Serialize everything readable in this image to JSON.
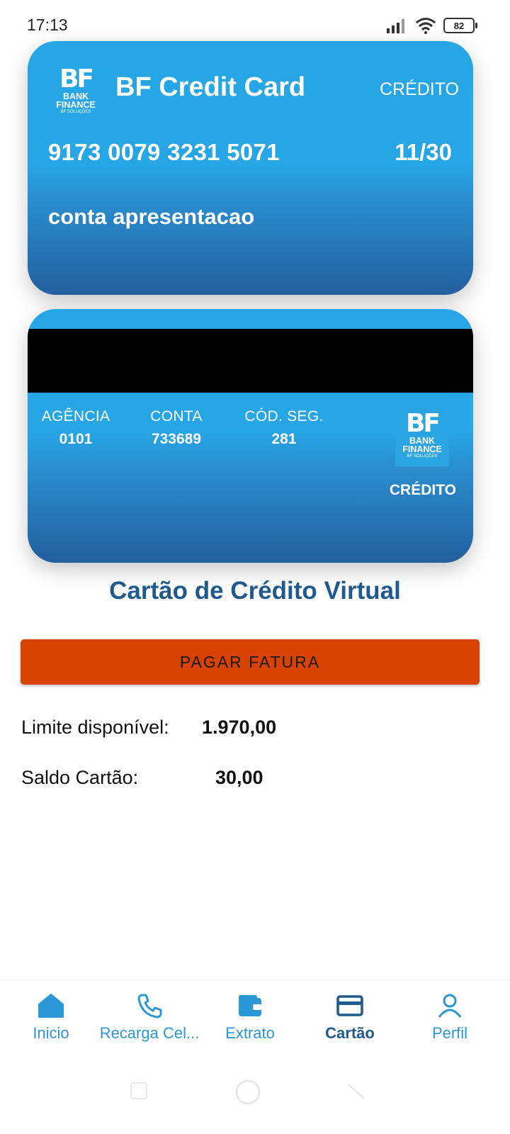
{
  "status_bar": {
    "time": "17:13",
    "battery": "82",
    "icons": [
      "signal-icon",
      "wifi-icon",
      "battery-icon"
    ]
  },
  "card_front": {
    "logo": {
      "monogram": "BF",
      "name": "BANK FINANCE",
      "tagline": "BF SOLUÇÕES"
    },
    "title": "BF Credit Card",
    "type": "CRÉDITO",
    "number": "9173 0079 3231 5071",
    "expiry": "11/30",
    "holder": "conta apresentacao"
  },
  "card_back": {
    "agencia_label": "AGÊNCIA",
    "agencia_value": "0101",
    "conta_label": "CONTA",
    "conta_value": "733689",
    "cod_label": "CÓD. SEG.",
    "cod_value": "281",
    "logo": {
      "monogram": "BF",
      "name": "BANK FINANCE",
      "tagline": "BF SOLUÇÕES"
    },
    "type": "CRÉDITO"
  },
  "main": {
    "title": "Cartão de Crédito Virtual",
    "pay_button": "PAGAR FATURA",
    "limit_label": "Limite disponível:",
    "limit_value": "1.970,00",
    "saldo_label": "Saldo Cartão:",
    "saldo_value": "30,00"
  },
  "nav": {
    "items": [
      {
        "label": "Inicio",
        "icon": "home-icon"
      },
      {
        "label": "Recarga Cel...",
        "icon": "phone-icon"
      },
      {
        "label": "Extrato",
        "icon": "wallet-icon"
      },
      {
        "label": "Cartão",
        "icon": "credit-card-icon",
        "active": true
      },
      {
        "label": "Perfil",
        "icon": "person-icon"
      }
    ]
  },
  "colors": {
    "card_blue": "#27a6e6",
    "card_dark": "#235f9e",
    "accent_orange": "#d84303",
    "title_blue": "#1f5a8f",
    "nav_blue": "#2c97d7"
  }
}
